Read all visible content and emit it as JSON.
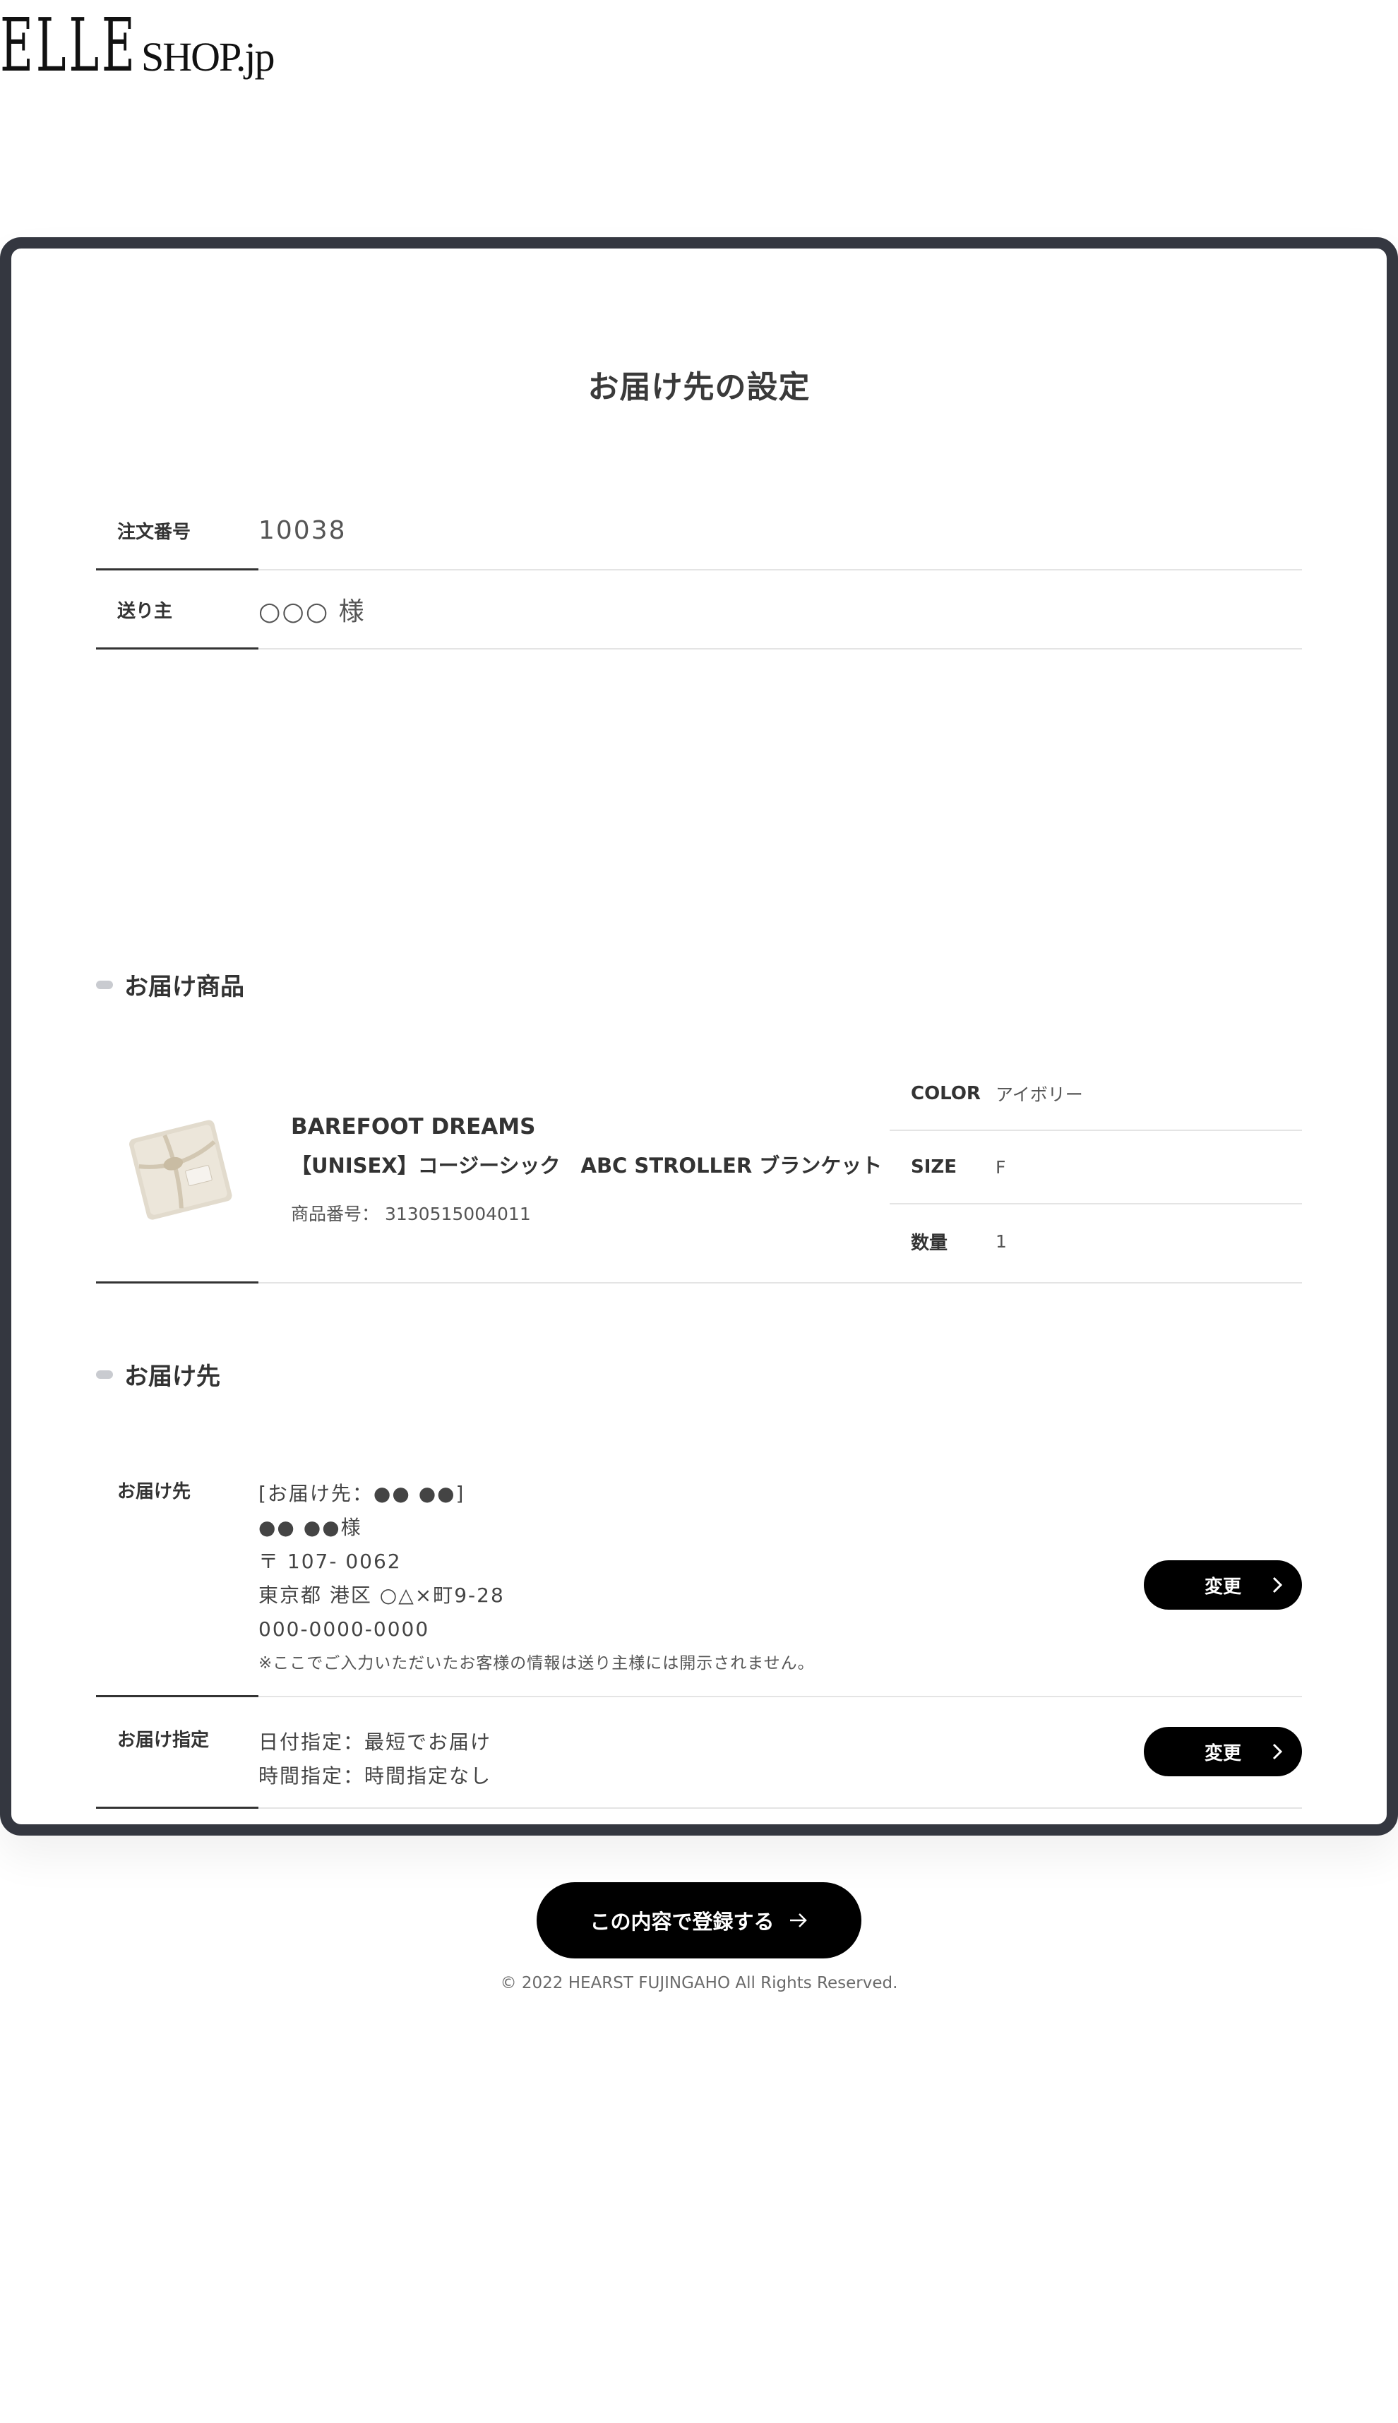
{
  "logo": {
    "elle": "ELLE",
    "shop": "SHOP.jp"
  },
  "page_title": "お届け先の設定",
  "order_info": {
    "order_number_label": "注文番号",
    "order_number": "10038",
    "sender_label": "送り主",
    "sender": "○○○ 様"
  },
  "product_section": {
    "heading": "お届け商品",
    "brand": "BAREFOOT DREAMS",
    "name": "【UNISEX】コージーシック　ABC STROLLER ブランケット",
    "code": "商品番号： 3130515004011",
    "specs": [
      {
        "label": "COLOR",
        "value": "アイボリー"
      },
      {
        "label": "SIZE",
        "value": "F"
      },
      {
        "label": "数量",
        "value": "1"
      }
    ]
  },
  "delivery_section": {
    "heading": "お届け先",
    "address_label": "お届け先",
    "address_lines": [
      "[お届け先：●● ●●]",
      "●● ●●様",
      "〒 107- 0062",
      "東京都 港区 ○△×町9-28",
      "000-0000-0000"
    ],
    "address_note": "※ここでご入力いただいたお客様の情報は送り主様には開示されません。",
    "spec_label": "お届け指定",
    "spec_lines": [
      "日付指定：最短でお届け",
      "時間指定：時間指定なし"
    ],
    "change_label": "変更"
  },
  "submit_label": "この内容で登録する",
  "footer": "© 2022 HEARST FUJINGAHO All Rights Reserved."
}
